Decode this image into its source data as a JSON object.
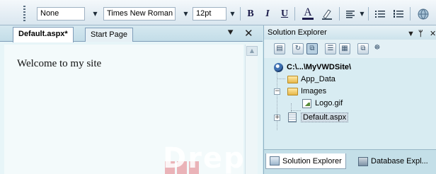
{
  "toolbar": {
    "block_format": "None",
    "font_family": "Times New Roman",
    "font_size": "12pt",
    "bold_label": "B",
    "italic_label": "I",
    "underline_label": "U",
    "forecolor_label": "A"
  },
  "editor": {
    "tabs": [
      {
        "label": "Default.aspx*",
        "active": true
      },
      {
        "label": "Start Page",
        "active": false
      }
    ],
    "content_text": "Welcome to my site",
    "watermark": "Drep"
  },
  "solution_explorer": {
    "title": "Solution Explorer",
    "tree": {
      "root": "C:\\...\\MyVWDSite\\",
      "items": [
        {
          "label": "App_Data",
          "type": "folder"
        },
        {
          "label": "Images",
          "type": "folder",
          "expanded": true
        },
        {
          "label": "Logo.gif",
          "type": "image"
        },
        {
          "label": "Default.aspx",
          "type": "page",
          "selected": true
        }
      ]
    },
    "bottom_tabs": [
      {
        "label": "Solution Explorer",
        "active": true
      },
      {
        "label": "Database Expl...",
        "active": false
      }
    ]
  },
  "colors": {
    "editor_bg": "#e7f5f8",
    "panel_bg": "#d8ecf2",
    "accent": "#7f9db9"
  }
}
